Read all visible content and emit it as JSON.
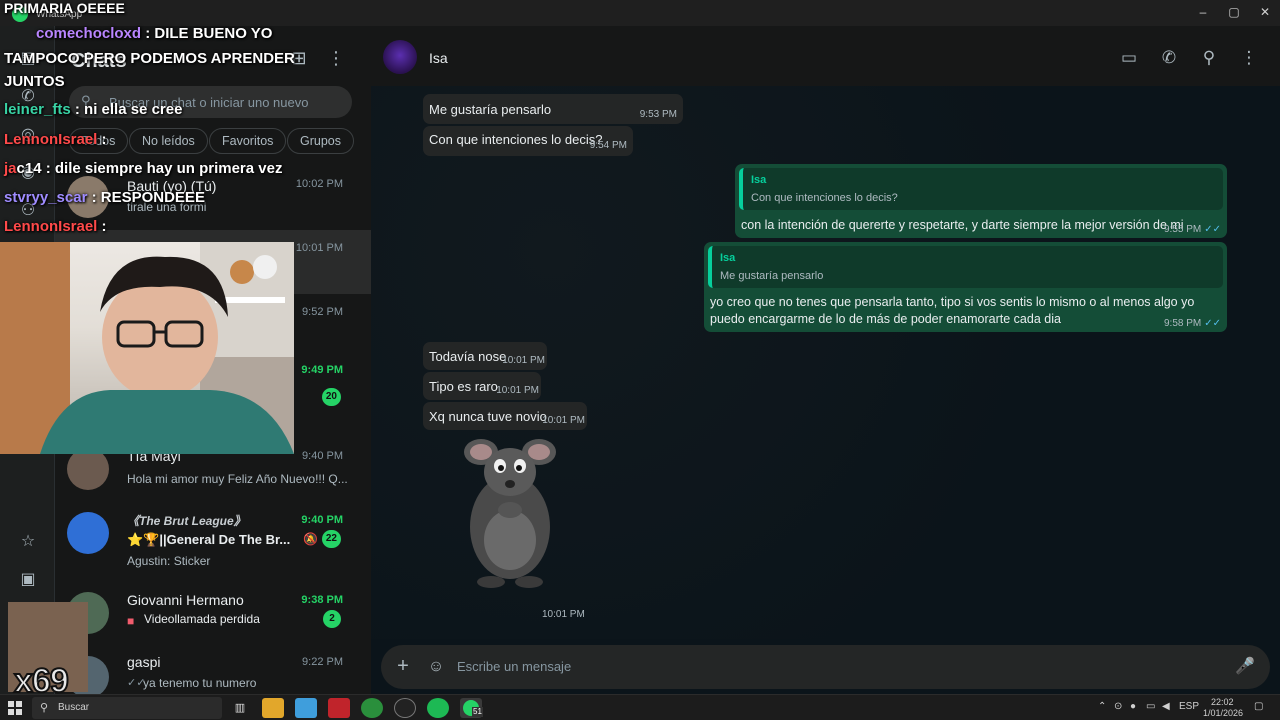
{
  "window": {
    "app_name": "WhatsApp",
    "controls": {
      "minimize": "–",
      "maximize": "▢",
      "close": "✕"
    }
  },
  "overlay": {
    "top_line": "PRIMARIA OEEEE",
    "chat": [
      {
        "user": "comechocloxd",
        "user_color": "#b985ff",
        "text": " : DILE BUENO YO"
      },
      {
        "user": "",
        "user_color": "#ffffff",
        "text": "TAMPOCO PERO PODEMOS APRENDER"
      },
      {
        "user": "",
        "user_color": "#ffffff",
        "text": "JUNTOS"
      },
      {
        "user": "leiner_fts",
        "user_color": "#39d3a5",
        "text": " : ni ella se cree"
      },
      {
        "user": "LennonIsrael",
        "user_color": "#ff4a4a",
        "text": " :"
      },
      {
        "user": "ja",
        "user_color": "#ff4a4a",
        "text": "c14 : dile siempre hay un primera vez"
      },
      {
        "user": "stvryy_scar",
        "user_color": "#9f8cff",
        "text": " : RESPONDEEE"
      },
      {
        "user": "LennonIsrael",
        "user_color": "#ff4a4a",
        "text": " :"
      }
    ],
    "emote_label": "x69"
  },
  "sidebar": {
    "title": "Chats",
    "search_placeholder": "Buscar un chat o iniciar uno nuevo",
    "filters": [
      "Todos",
      "No leídos",
      "Favoritos",
      "Grupos"
    ],
    "items": [
      {
        "name": "Bauti (yo) (Tú)",
        "preview": "tirale una formi",
        "time": "10:02 PM",
        "unread": false,
        "badge": ""
      },
      {
        "name": "",
        "preview": "",
        "time": "10:01 PM",
        "unread": false,
        "badge": ""
      },
      {
        "name": "",
        "preview": "",
        "time": "9:52 PM",
        "unread": false,
        "badge": ""
      },
      {
        "name": "",
        "preview": "",
        "time": "9:49 PM",
        "unread": true,
        "badge": "20"
      },
      {
        "name": "Tía Mayi",
        "preview": "Hola mi amor muy Feliz Año Nuevo!!! Q...",
        "time": "9:40 PM",
        "unread": false,
        "badge": ""
      },
      {
        "name": "《The Brut League》",
        "preview": "⭐🏆||General De The Br...",
        "preview2": "Agustin: Sticker",
        "time": "9:40 PM",
        "unread": true,
        "badge": "22"
      },
      {
        "name": "Giovanni Hermano",
        "preview": "Videollamada perdida",
        "time": "9:38 PM",
        "unread": true,
        "badge": "2"
      },
      {
        "name": "gaspi",
        "preview": "ya tenemo tu numero",
        "time": "9:22 PM",
        "unread": false,
        "badge": ""
      }
    ]
  },
  "conversation": {
    "contact_name": "Isa",
    "messages": [
      {
        "dir": "in",
        "text": "Me gustaría pensarlo",
        "time": "9:53 PM"
      },
      {
        "dir": "in",
        "text": "Con que intenciones lo decis?",
        "time": "9:54 PM"
      },
      {
        "dir": "out",
        "quote_name": "Isa",
        "quote_text": "Con que intenciones lo decis?",
        "text": "con la intención de quererte y respetarte, y darte siempre la mejor versión de mi",
        "time": "9:55 PM"
      },
      {
        "dir": "out",
        "quote_name": "Isa",
        "quote_text": "Me gustaría pensarlo",
        "text": "yo creo que no tenes que pensarla tanto, tipo si vos sentis lo mismo o al menos algo yo puedo encargarme de lo de más de poder enamorarte cada dia",
        "time": "9:58 PM"
      },
      {
        "dir": "in",
        "text": "Todavía nose",
        "time": "10:01 PM"
      },
      {
        "dir": "in",
        "text": "Tipo es raro",
        "time": "10:01 PM"
      },
      {
        "dir": "in",
        "text": "Xq nunca tuve novio",
        "time": "10:01 PM"
      },
      {
        "dir": "in",
        "sticker": "rat-sticker",
        "time": "10:01 PM"
      }
    ],
    "composer_placeholder": "Escribe un mensaje"
  },
  "taskbar": {
    "search_label": "Buscar",
    "lang": "ESP",
    "time": "22:02",
    "date": "1/01/2026",
    "whatsapp_badge": "51"
  },
  "colors": {
    "accent": "#25d366",
    "outgoing_bubble": "#144d37",
    "incoming_bubble": "#242626"
  }
}
